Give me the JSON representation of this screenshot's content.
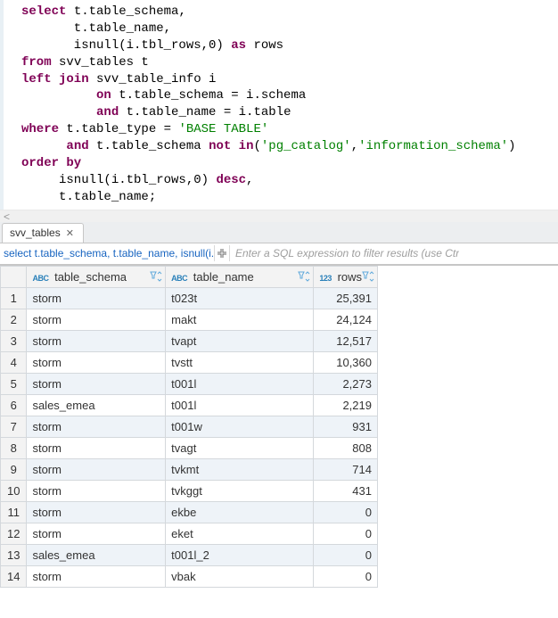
{
  "sql": {
    "lines": [
      [
        [
          "kw",
          "select"
        ],
        [
          "id",
          " t.table_schema,"
        ]
      ],
      [
        [
          "id",
          "       t.table_name,"
        ]
      ],
      [
        [
          "id",
          "       isnull(i.tbl_rows,0) "
        ],
        [
          "kw",
          "as"
        ],
        [
          "id",
          " rows"
        ]
      ],
      [
        [
          "kw",
          "from"
        ],
        [
          "id",
          " svv_tables t"
        ]
      ],
      [
        [
          "kw",
          "left join"
        ],
        [
          "id",
          " svv_table_info i"
        ]
      ],
      [
        [
          "id",
          "          "
        ],
        [
          "kw",
          "on"
        ],
        [
          "id",
          " t.table_schema = i.schema"
        ]
      ],
      [
        [
          "id",
          "          "
        ],
        [
          "kw",
          "and"
        ],
        [
          "id",
          " t.table_name = i.table"
        ]
      ],
      [
        [
          "kw",
          "where"
        ],
        [
          "id",
          " t.table_type = "
        ],
        [
          "str",
          "'BASE TABLE'"
        ]
      ],
      [
        [
          "id",
          "      "
        ],
        [
          "kw",
          "and"
        ],
        [
          "id",
          " t.table_schema "
        ],
        [
          "kw",
          "not in"
        ],
        [
          "id",
          "("
        ],
        [
          "str",
          "'pg_catalog'"
        ],
        [
          "id",
          ","
        ],
        [
          "str",
          "'information_schema'"
        ],
        [
          "id",
          ")"
        ]
      ],
      [
        [
          "kw",
          "order by"
        ]
      ],
      [
        [
          "id",
          "     isnull(i.tbl_rows,0) "
        ],
        [
          "kw",
          "desc"
        ],
        [
          "id",
          ","
        ]
      ],
      [
        [
          "id",
          "     t.table_name;"
        ]
      ]
    ],
    "scroll_hint": "<"
  },
  "tab": {
    "label": "svv_tables",
    "close_glyph": "✕"
  },
  "filter": {
    "sql_preview": "select t.table_schema, t.table_name, isnull(i.tbl",
    "expand_icon": "expand-icon",
    "hint": "Enter a SQL expression to filter results (use Ctr"
  },
  "columns": [
    {
      "type_label": "ABC",
      "name": "table_schema"
    },
    {
      "type_label": "ABC",
      "name": "table_name"
    },
    {
      "type_label": "123",
      "name": "rows"
    }
  ],
  "rows": [
    {
      "n": "1",
      "table_schema": "storm",
      "table_name": "t023t",
      "rows": "25,391",
      "selected": true
    },
    {
      "n": "2",
      "table_schema": "storm",
      "table_name": "makt",
      "rows": "24,124"
    },
    {
      "n": "3",
      "table_schema": "storm",
      "table_name": "tvapt",
      "rows": "12,517"
    },
    {
      "n": "4",
      "table_schema": "storm",
      "table_name": "tvstt",
      "rows": "10,360"
    },
    {
      "n": "5",
      "table_schema": "storm",
      "table_name": "t001l",
      "rows": "2,273"
    },
    {
      "n": "6",
      "table_schema": "sales_emea",
      "table_name": "t001l",
      "rows": "2,219"
    },
    {
      "n": "7",
      "table_schema": "storm",
      "table_name": "t001w",
      "rows": "931"
    },
    {
      "n": "8",
      "table_schema": "storm",
      "table_name": "tvagt",
      "rows": "808"
    },
    {
      "n": "9",
      "table_schema": "storm",
      "table_name": "tvkmt",
      "rows": "714"
    },
    {
      "n": "10",
      "table_schema": "storm",
      "table_name": "tvkggt",
      "rows": "431"
    },
    {
      "n": "11",
      "table_schema": "storm",
      "table_name": "ekbe",
      "rows": "0"
    },
    {
      "n": "12",
      "table_schema": "storm",
      "table_name": "eket",
      "rows": "0"
    },
    {
      "n": "13",
      "table_schema": "sales_emea",
      "table_name": "t001l_2",
      "rows": "0"
    },
    {
      "n": "14",
      "table_schema": "storm",
      "table_name": "vbak",
      "rows": "0"
    }
  ]
}
